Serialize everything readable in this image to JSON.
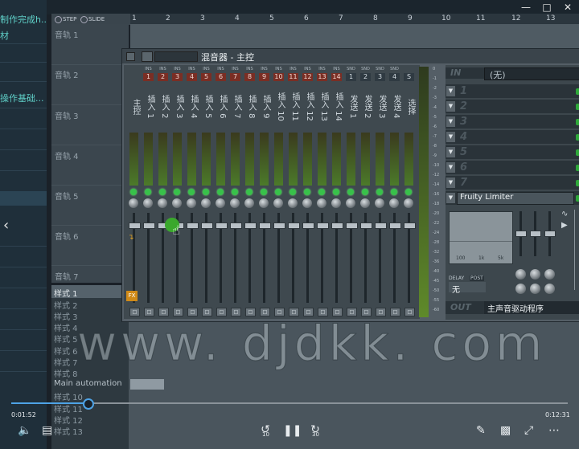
{
  "player": {
    "time_current": "0:01:52",
    "time_total": "0:12:31",
    "progress": 0.137,
    "back_label": "10",
    "forward_label": "30"
  },
  "sidebar": {
    "items": [
      "制作完成h...",
      "材",
      "操作基础..."
    ]
  },
  "topbar": {
    "step_label": "STEP",
    "slide_label": "SLIDE"
  },
  "ruler": {
    "numbers": [
      "1",
      "2",
      "3",
      "4",
      "5",
      "6",
      "7",
      "8",
      "9",
      "10",
      "11",
      "12",
      "13"
    ]
  },
  "tracks": [
    "音轨 1",
    "音轨 2",
    "音轨 3",
    "音轨 4",
    "音轨 5",
    "音轨 6",
    "音轨 7"
  ],
  "patterns": [
    "样式 1",
    "样式 2",
    "样式 3",
    "样式 4",
    "样式 5",
    "样式 6",
    "样式 7",
    "样式 8",
    "Main automation",
    "样式 10",
    "样式 11",
    "样式 12",
    "样式 13"
  ],
  "mixer": {
    "title": "混音器 - 主控",
    "strips": [
      {
        "tag": "",
        "num": "",
        "name": "主控"
      },
      {
        "tag": "INS",
        "num": "1",
        "name": "插入 1"
      },
      {
        "tag": "INS",
        "num": "2",
        "name": "插入 2"
      },
      {
        "tag": "INS",
        "num": "3",
        "name": "插入 3"
      },
      {
        "tag": "INS",
        "num": "4",
        "name": "插入 4"
      },
      {
        "tag": "INS",
        "num": "5",
        "name": "插入 5"
      },
      {
        "tag": "INS",
        "num": "6",
        "name": "插入 6"
      },
      {
        "tag": "INS",
        "num": "7",
        "name": "插入 7"
      },
      {
        "tag": "INS",
        "num": "8",
        "name": "插入 8"
      },
      {
        "tag": "INS",
        "num": "9",
        "name": "插入 9"
      },
      {
        "tag": "INS",
        "num": "10",
        "name": "插入 10"
      },
      {
        "tag": "INS",
        "num": "11",
        "name": "插入 11"
      },
      {
        "tag": "INS",
        "num": "12",
        "name": "插入 12"
      },
      {
        "tag": "INS",
        "num": "13",
        "name": "插入 13"
      },
      {
        "tag": "INS",
        "num": "14",
        "name": "插入 14"
      },
      {
        "tag": "SND",
        "num": "1",
        "name": "发送 1"
      },
      {
        "tag": "SND",
        "num": "2",
        "name": "发送 2"
      },
      {
        "tag": "SND",
        "num": "3",
        "name": "发送 3"
      },
      {
        "tag": "SND",
        "num": "4",
        "name": "发送 4"
      },
      {
        "tag": "",
        "num": "S",
        "name": "选择"
      }
    ],
    "fx_label": "FX",
    "scale": [
      "0",
      "-1",
      "-2",
      "-3",
      "-4",
      "-5",
      "-6",
      "-7",
      "-8",
      "-9",
      "-10",
      "-12",
      "-14",
      "-16",
      "-18",
      "-20",
      "-22",
      "-24",
      "-28",
      "-32",
      "-36",
      "-40",
      "-45",
      "-50",
      "-55",
      "-60"
    ]
  },
  "fxpanel": {
    "in_label": "IN",
    "in_value": "(无)",
    "slots": [
      "1",
      "2",
      "3",
      "4",
      "5",
      "6",
      "7"
    ],
    "limiter": "Fruity Limiter",
    "eq_labels": [
      "100",
      "1k",
      "5k"
    ],
    "delay_label": "DELAY",
    "post_label": "POST",
    "delay_value": "无",
    "out_label": "OUT",
    "out_value": "主声音驱动程序"
  },
  "watermark": "www. djdkk. com"
}
